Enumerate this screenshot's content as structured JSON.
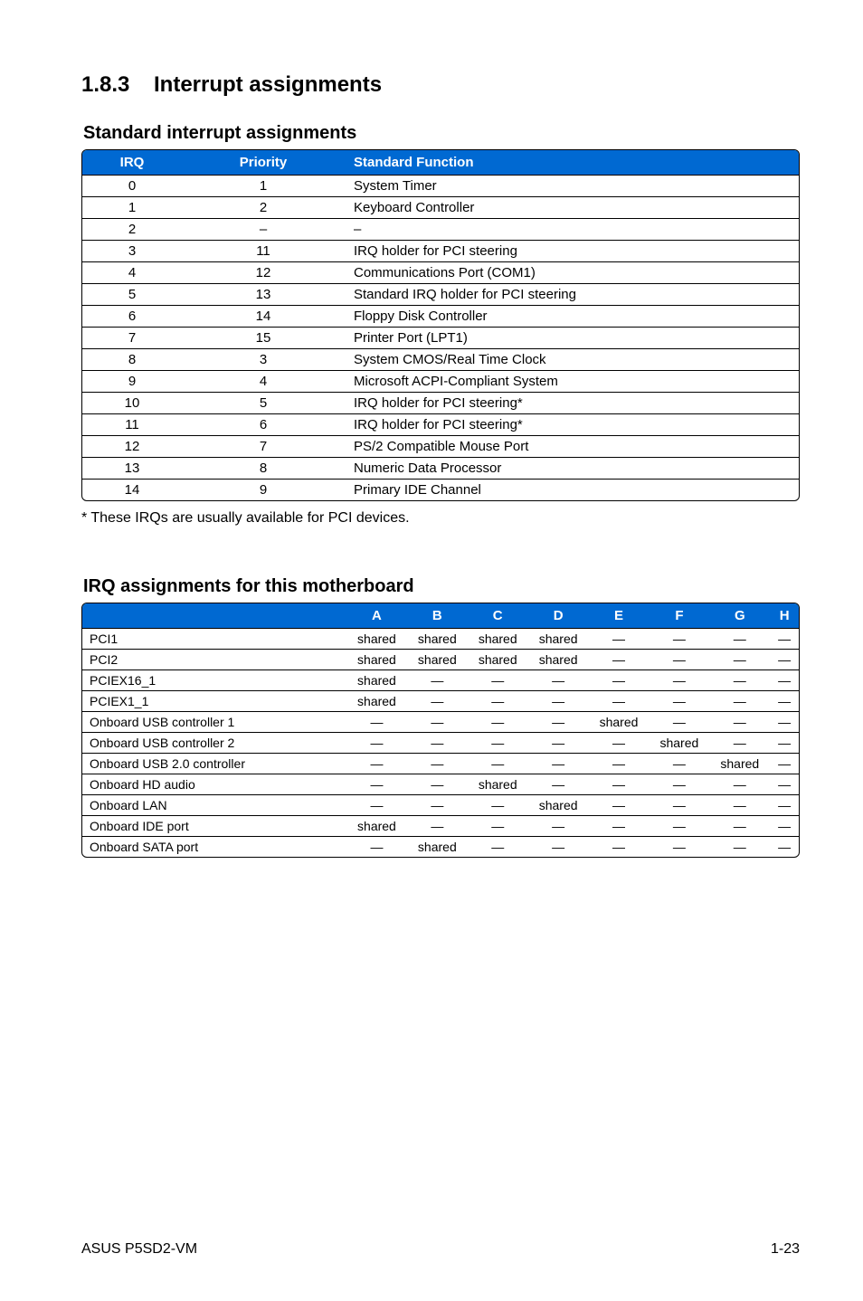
{
  "section": {
    "number": "1.8.3",
    "title": "Interrupt assignments"
  },
  "table1": {
    "heading": "Standard interrupt assignments",
    "columns": {
      "irq": "IRQ",
      "priority": "Priority",
      "func": "Standard Function"
    },
    "rows": [
      {
        "irq": "0",
        "priority": "1",
        "func": "System Timer"
      },
      {
        "irq": "1",
        "priority": "2",
        "func": "Keyboard Controller"
      },
      {
        "irq": "2",
        "priority": "–",
        "func": "–"
      },
      {
        "irq": "3",
        "priority": "11",
        "func": "IRQ holder for PCI steering"
      },
      {
        "irq": "4",
        "priority": "12",
        "func": "Communications Port (COM1)"
      },
      {
        "irq": "5",
        "priority": "13",
        "func": "Standard IRQ holder for PCI steering"
      },
      {
        "irq": "6",
        "priority": "14",
        "func": "Floppy Disk Controller"
      },
      {
        "irq": "7",
        "priority": "15",
        "func": "Printer Port (LPT1)"
      },
      {
        "irq": "8",
        "priority": "3",
        "func": "System CMOS/Real Time Clock"
      },
      {
        "irq": "9",
        "priority": "4",
        "func": "Microsoft ACPI-Compliant System"
      },
      {
        "irq": "10",
        "priority": "5",
        "func": "IRQ holder for PCI steering*"
      },
      {
        "irq": "11",
        "priority": "6",
        "func": "IRQ holder for PCI steering*"
      },
      {
        "irq": "12",
        "priority": "7",
        "func": "PS/2 Compatible Mouse Port"
      },
      {
        "irq": "13",
        "priority": "8",
        "func": "Numeric Data Processor"
      },
      {
        "irq": "14",
        "priority": "9",
        "func": "Primary IDE Channel"
      }
    ],
    "footnote": "* These IRQs are usually available for PCI devices."
  },
  "table2": {
    "heading": "IRQ assignments for this motherboard",
    "columns": [
      "",
      "A",
      "B",
      "C",
      "D",
      "E",
      "F",
      "G",
      "H"
    ],
    "rows": [
      {
        "label": "PCI1",
        "cells": [
          "shared",
          "shared",
          "shared",
          "shared",
          "—",
          "—",
          "—",
          "—"
        ]
      },
      {
        "label": "PCI2",
        "cells": [
          "shared",
          "shared",
          "shared",
          "shared",
          "—",
          "—",
          "—",
          "—"
        ]
      },
      {
        "label": "PCIEX16_1",
        "cells": [
          "shared",
          "—",
          "—",
          "—",
          "—",
          "—",
          "—",
          "—"
        ]
      },
      {
        "label": "PCIEX1_1",
        "cells": [
          "shared",
          "—",
          "—",
          "—",
          "—",
          "—",
          "—",
          "—"
        ]
      },
      {
        "label": "Onboard USB controller 1",
        "cells": [
          "—",
          "—",
          "—",
          "—",
          "shared",
          "—",
          "—",
          "—"
        ]
      },
      {
        "label": "Onboard USB controller 2",
        "cells": [
          "—",
          "—",
          "—",
          "—",
          "—",
          "shared",
          "—",
          "—"
        ]
      },
      {
        "label": "Onboard USB 2.0 controller",
        "cells": [
          "—",
          "—",
          "—",
          "—",
          "—",
          "—",
          "shared",
          "—"
        ]
      },
      {
        "label": "Onboard HD audio",
        "cells": [
          "—",
          "—",
          "shared",
          "—",
          "—",
          "—",
          "—",
          "—"
        ]
      },
      {
        "label": "Onboard LAN",
        "cells": [
          "—",
          "—",
          "—",
          "shared",
          "—",
          "—",
          "—",
          "—"
        ]
      },
      {
        "label": "Onboard IDE port",
        "cells": [
          "shared",
          "—",
          "—",
          "—",
          "—",
          "—",
          "—",
          "—"
        ]
      },
      {
        "label": "Onboard SATA port",
        "cells": [
          "—",
          "shared",
          "—",
          "—",
          "—",
          "—",
          "—",
          "—"
        ]
      }
    ]
  },
  "footer": {
    "left": "ASUS P5SD2-VM",
    "right": "1-23"
  }
}
